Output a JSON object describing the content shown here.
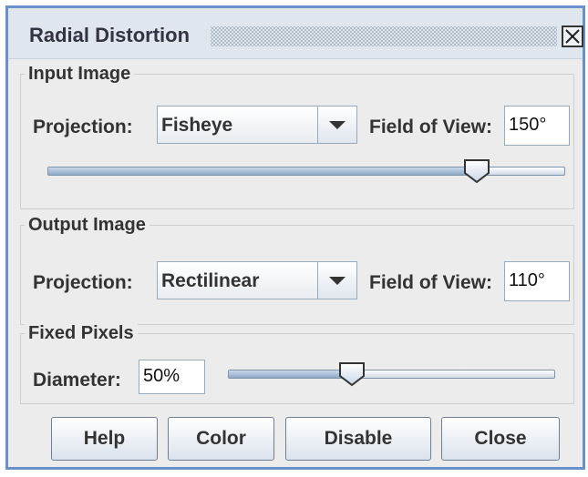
{
  "window": {
    "title": "Radial Distortion",
    "close_icon": "close-icon"
  },
  "input_image": {
    "title": "Input Image",
    "projection_label": "Projection:",
    "projection_value": "Fisheye",
    "fov_label": "Field of View:",
    "fov_value": "150°",
    "slider_fraction": 0.83
  },
  "output_image": {
    "title": "Output Image",
    "projection_label": "Projection:",
    "projection_value": "Rectilinear",
    "fov_label": "Field of View:",
    "fov_value": "110°"
  },
  "fixed_pixels": {
    "title": "Fixed Pixels",
    "diameter_label": "Diameter:",
    "diameter_value": "50%",
    "slider_fraction": 0.38
  },
  "buttons": {
    "help": "Help",
    "color": "Color",
    "disable": "Disable",
    "close": "Close"
  },
  "colors": {
    "window_border": "#6b91cc",
    "titlebar": "#dfe6ee",
    "panel": "#ececec"
  }
}
